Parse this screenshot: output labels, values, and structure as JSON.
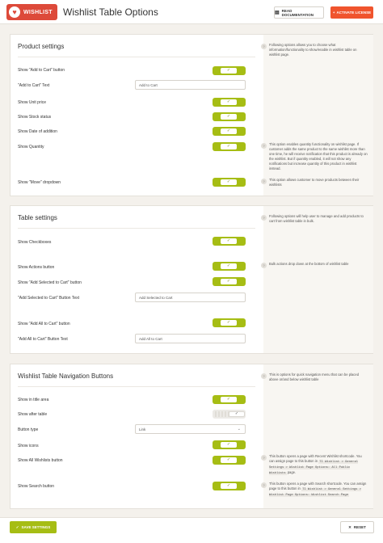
{
  "header": {
    "logo_text": "WISHLIST",
    "title": "Wishlist Table Options",
    "docs_button": "READ DOCUMENTATION",
    "license_button": "ACTIVATE LICENSE"
  },
  "product_settings": {
    "title": "Product settings",
    "rows": {
      "add_to_cart_button": "Show \"Add to Cart\" button",
      "add_to_cart_text": "\"Add to Cart\" Text",
      "unit_price": "Show Unit price",
      "stock_status": "Show Stock status",
      "date_of_addition": "Show Date of addition",
      "quantity": "Show Quantity",
      "move_dropdown": "Show \"Move\" dropdown"
    },
    "add_to_cart_value": "Add to Cart",
    "help": [
      {
        "num": "?",
        "text": "Following options allows you to choose what information/functionality to show/enable in wishlist table on wishlist page."
      },
      {
        "num": "?",
        "text": "This option enables quantity functionality on wishlist page. If customer adds the same product to the same wishlist more than one time, he will receive notification that this product is already on the wishlist. But if quantity enabled, it will not show any notifications but increase quantity of this product in wishlist instead."
      },
      {
        "num": "?",
        "text": "This option allows customer to move products between their wishlists"
      }
    ]
  },
  "table_settings": {
    "title": "Table settings",
    "rows": {
      "checkboxes": "Show Checkboxes",
      "actions_button": "Show Actions button",
      "add_selected_button": "Show \"Add Selected to Cart\" button",
      "add_selected_text": "\"Add Selected to Cart\" Button Text",
      "add_all_button": "Show \"Add All to Cart\" button",
      "add_all_text": "\"Add All to Cart\" Button Text"
    },
    "add_selected_value": "Add Selected to Cart",
    "add_all_value": "Add All to Cart",
    "help": [
      {
        "num": "?",
        "text": "Following options will help user to manage and add products to cart from wishlist table in bulk."
      },
      {
        "num": "?",
        "text": "Bulk actions drop down at the bottom of wishlist table"
      }
    ]
  },
  "nav_buttons": {
    "title": "Wishlist Table Navigation Buttons",
    "rows": {
      "title_area": "Show in title area",
      "after_table": "Show after table",
      "button_type": "Button type",
      "icons": "Show icons",
      "all_wishlists": "Show All Wishlists button",
      "search": "Show Search button"
    },
    "button_type_value": "Link",
    "help": [
      {
        "num": "?",
        "text": "This is options for quick navigation menu that can be placed above or/and below wishlist table"
      },
      {
        "num": "?",
        "text_before": "This button opens a page with Recent Wishlist shortcode. You can assign page to this button in",
        "code": "TI Wishlist > General Settings > Wishlist Page Options: All Public Wishlists",
        "text_after": "page."
      },
      {
        "num": "?",
        "text_before": "This button opens a page with Search shortcode. You can assign page to this button in",
        "code": "TI Wishlist > General Settings > Wishlist Page Options: Wishlist Search Page",
        "text_after": ""
      }
    ]
  },
  "footer": {
    "save_button": "SAVE SETTINGS",
    "reset_button": "RESET"
  },
  "colors": {
    "accent": "#a6bd14",
    "license": "#f0542d",
    "logo": "#dd4a3a"
  }
}
